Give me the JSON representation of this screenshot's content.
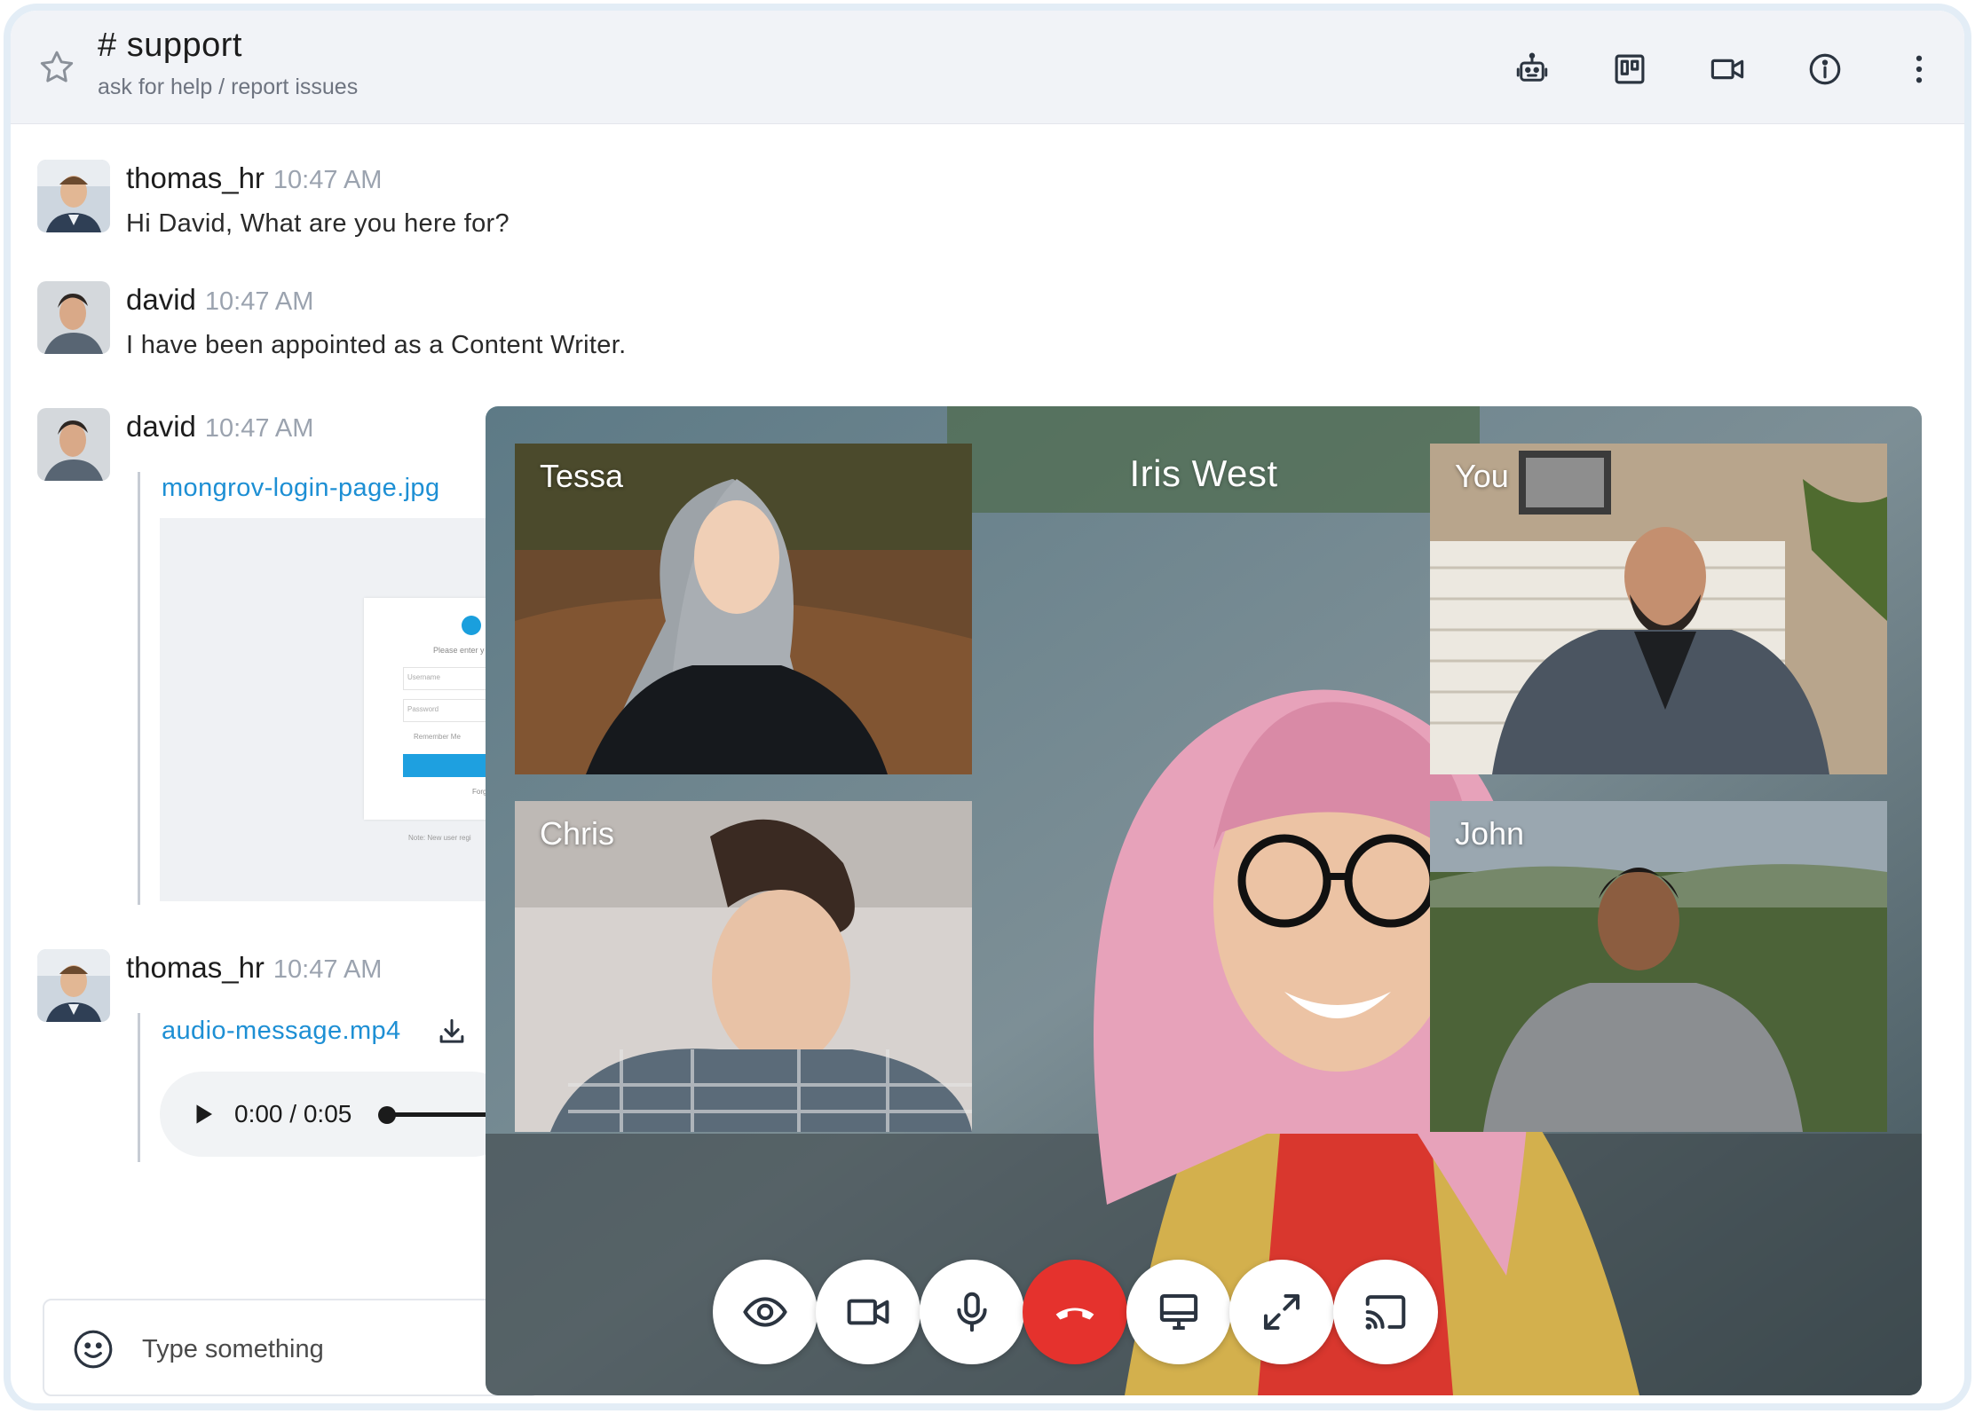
{
  "header": {
    "channel_name": "# support",
    "channel_description": "ask for help / report issues",
    "icons": [
      "star-icon",
      "bot-icon",
      "kanban-icon",
      "video-icon",
      "info-icon",
      "more-vertical-icon"
    ]
  },
  "messages": [
    {
      "username": "thomas_hr",
      "time": "10:47 AM",
      "text": "Hi David, What are you here for?"
    },
    {
      "username": "david",
      "time": "10:47 AM",
      "text": "I have been appointed as a Content Writer."
    },
    {
      "username": "david",
      "time": "10:47 AM",
      "attachment": "mongrov-login-page.jpg",
      "preview_text": {
        "enter": "Please enter y",
        "username": "Username",
        "password": "Password",
        "remember": "Remember Me",
        "forgot": "Forg",
        "note": "Note: New user regi"
      }
    },
    {
      "username": "thomas_hr",
      "time": "10:47 AM",
      "attachment": "audio-message.mp4",
      "audio": {
        "current": "0:00",
        "separator": "/",
        "duration": "0:05",
        "progress": 0
      }
    }
  ],
  "composer": {
    "placeholder": "Type something"
  },
  "video_call": {
    "main_speaker": "Iris West",
    "tiles": [
      {
        "name": "Tessa"
      },
      {
        "name": "You"
      },
      {
        "name": "Chris"
      },
      {
        "name": "John"
      }
    ],
    "controls": [
      "eye-icon",
      "camera-icon",
      "microphone-icon",
      "end-call-icon",
      "screen-share-icon",
      "fullscreen-icon",
      "cast-icon"
    ],
    "end_call_color": "#e5322d"
  },
  "colors": {
    "link": "#1d8fd4",
    "header_bg": "#f1f3f7",
    "frame_border": "#e3edf6"
  }
}
